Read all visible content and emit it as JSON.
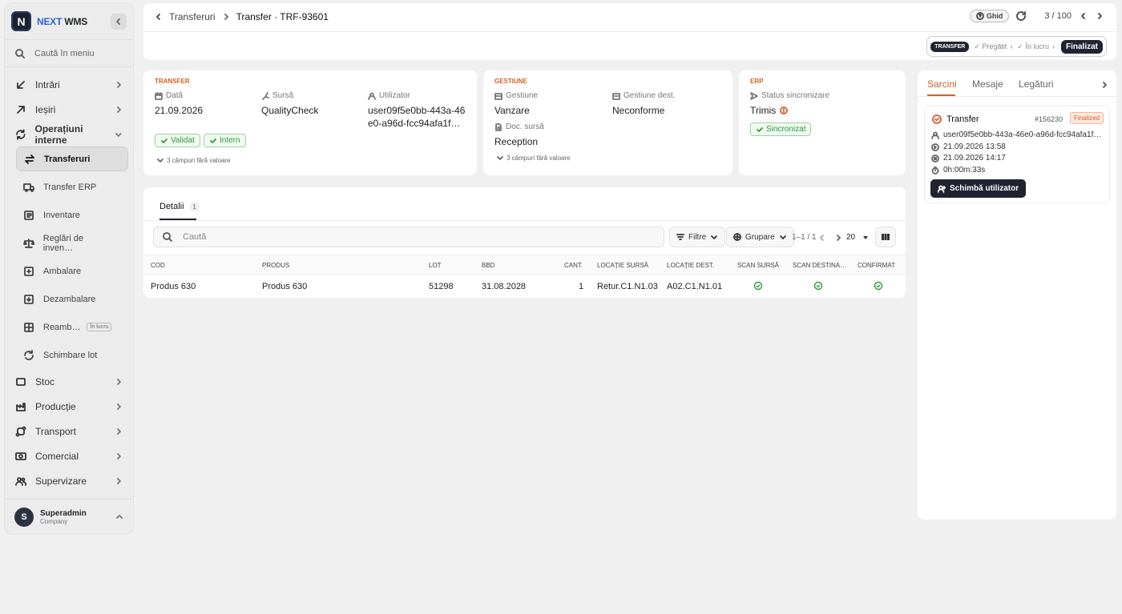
{
  "brand": {
    "a": "NEXT",
    "b": "WMS",
    "logo": "N"
  },
  "sidebar": {
    "search_placeholder": "Caută în meniu",
    "items": [
      {
        "label": "Intrări"
      },
      {
        "label": "Ieșiri"
      },
      {
        "label": "Operațiuni interne"
      }
    ],
    "sub": [
      {
        "label": "Transferuri"
      },
      {
        "label": "Transfer ERP"
      },
      {
        "label": "Inventare"
      },
      {
        "label": "Reglări de inven…"
      },
      {
        "label": "Ambalare"
      },
      {
        "label": "Dezambalare"
      },
      {
        "label": "Reamb…",
        "badge": "În lucru"
      },
      {
        "label": "Schimbare lot"
      }
    ],
    "items2": [
      {
        "label": "Stoc"
      },
      {
        "label": "Producție"
      },
      {
        "label": "Transport"
      },
      {
        "label": "Comercial"
      },
      {
        "label": "Supervizare"
      }
    ],
    "user": {
      "initial": "S",
      "name": "Superadmin",
      "company": "Company"
    }
  },
  "header": {
    "breadcrumb_parent": "Transferuri",
    "breadcrumb_current": "Transfer · TRF-93601",
    "ghid": "Ghid",
    "pager": "3 / 100",
    "stepper": {
      "type": "TRANSFER",
      "s1": "✓ Pregătit",
      "s2": "✓ În lucru",
      "final": "Finalizat"
    }
  },
  "card_transfer": {
    "section": "TRANSFER",
    "date_label": "Dată",
    "date": "21.09.2026",
    "source_label": "Sursă",
    "source": "QualityCheck",
    "user_label": "Utilizator",
    "user": "user09f5e0bb-443a-46e0-a96d-fcc94afa1f…",
    "tags": [
      "Validat",
      "Intern"
    ],
    "more": "3 câmpuri fără valoare"
  },
  "card_gestiune": {
    "section": "GESTIUNE",
    "g_label": "Gestiune",
    "g": "Vanzare",
    "gd_label": "Gestiune dest.",
    "gd": "Neconforme",
    "doc_label": "Doc. sursă",
    "doc": "Reception",
    "more": "3 câmpuri fără valoare"
  },
  "card_erp": {
    "section": "ERP",
    "status_label": "Status sincronizare",
    "status": "Trimis",
    "tag": "Sincronizat"
  },
  "details": {
    "tab": "Detalii",
    "count": "1",
    "search_placeholder": "Caută",
    "filters": "Filtre",
    "group": "Grupare",
    "range": "1–1 / 1",
    "page_size": "20",
    "columns": [
      "Cod",
      "Produs",
      "Lot",
      "BBD",
      "Cant.",
      "Locație sursă",
      "Locație dest.",
      "Scan sursă",
      "Scan destina…",
      "Confirmat"
    ],
    "rows": [
      {
        "cod": "Produs 630",
        "produs": "Produs 630",
        "lot": "51298",
        "bbd": "31.08.2028",
        "cant": "1",
        "src": "Retur.C1.N1.03",
        "dst": "A02.C1.N1.01"
      }
    ]
  },
  "rpanel": {
    "tabs": [
      "Sarcini",
      "Mesaje",
      "Legături"
    ],
    "task": {
      "title": "Transfer",
      "id": "#156230",
      "status": "Finalized",
      "user": "user09f5e0bb-443a-46e0-a96d-fcc94afa1f…",
      "start": "21.09.2026 13:58",
      "end": "21.09.2026 14:17",
      "duration": "0h:00m:33s",
      "button": "Schimbă utilizator"
    }
  }
}
